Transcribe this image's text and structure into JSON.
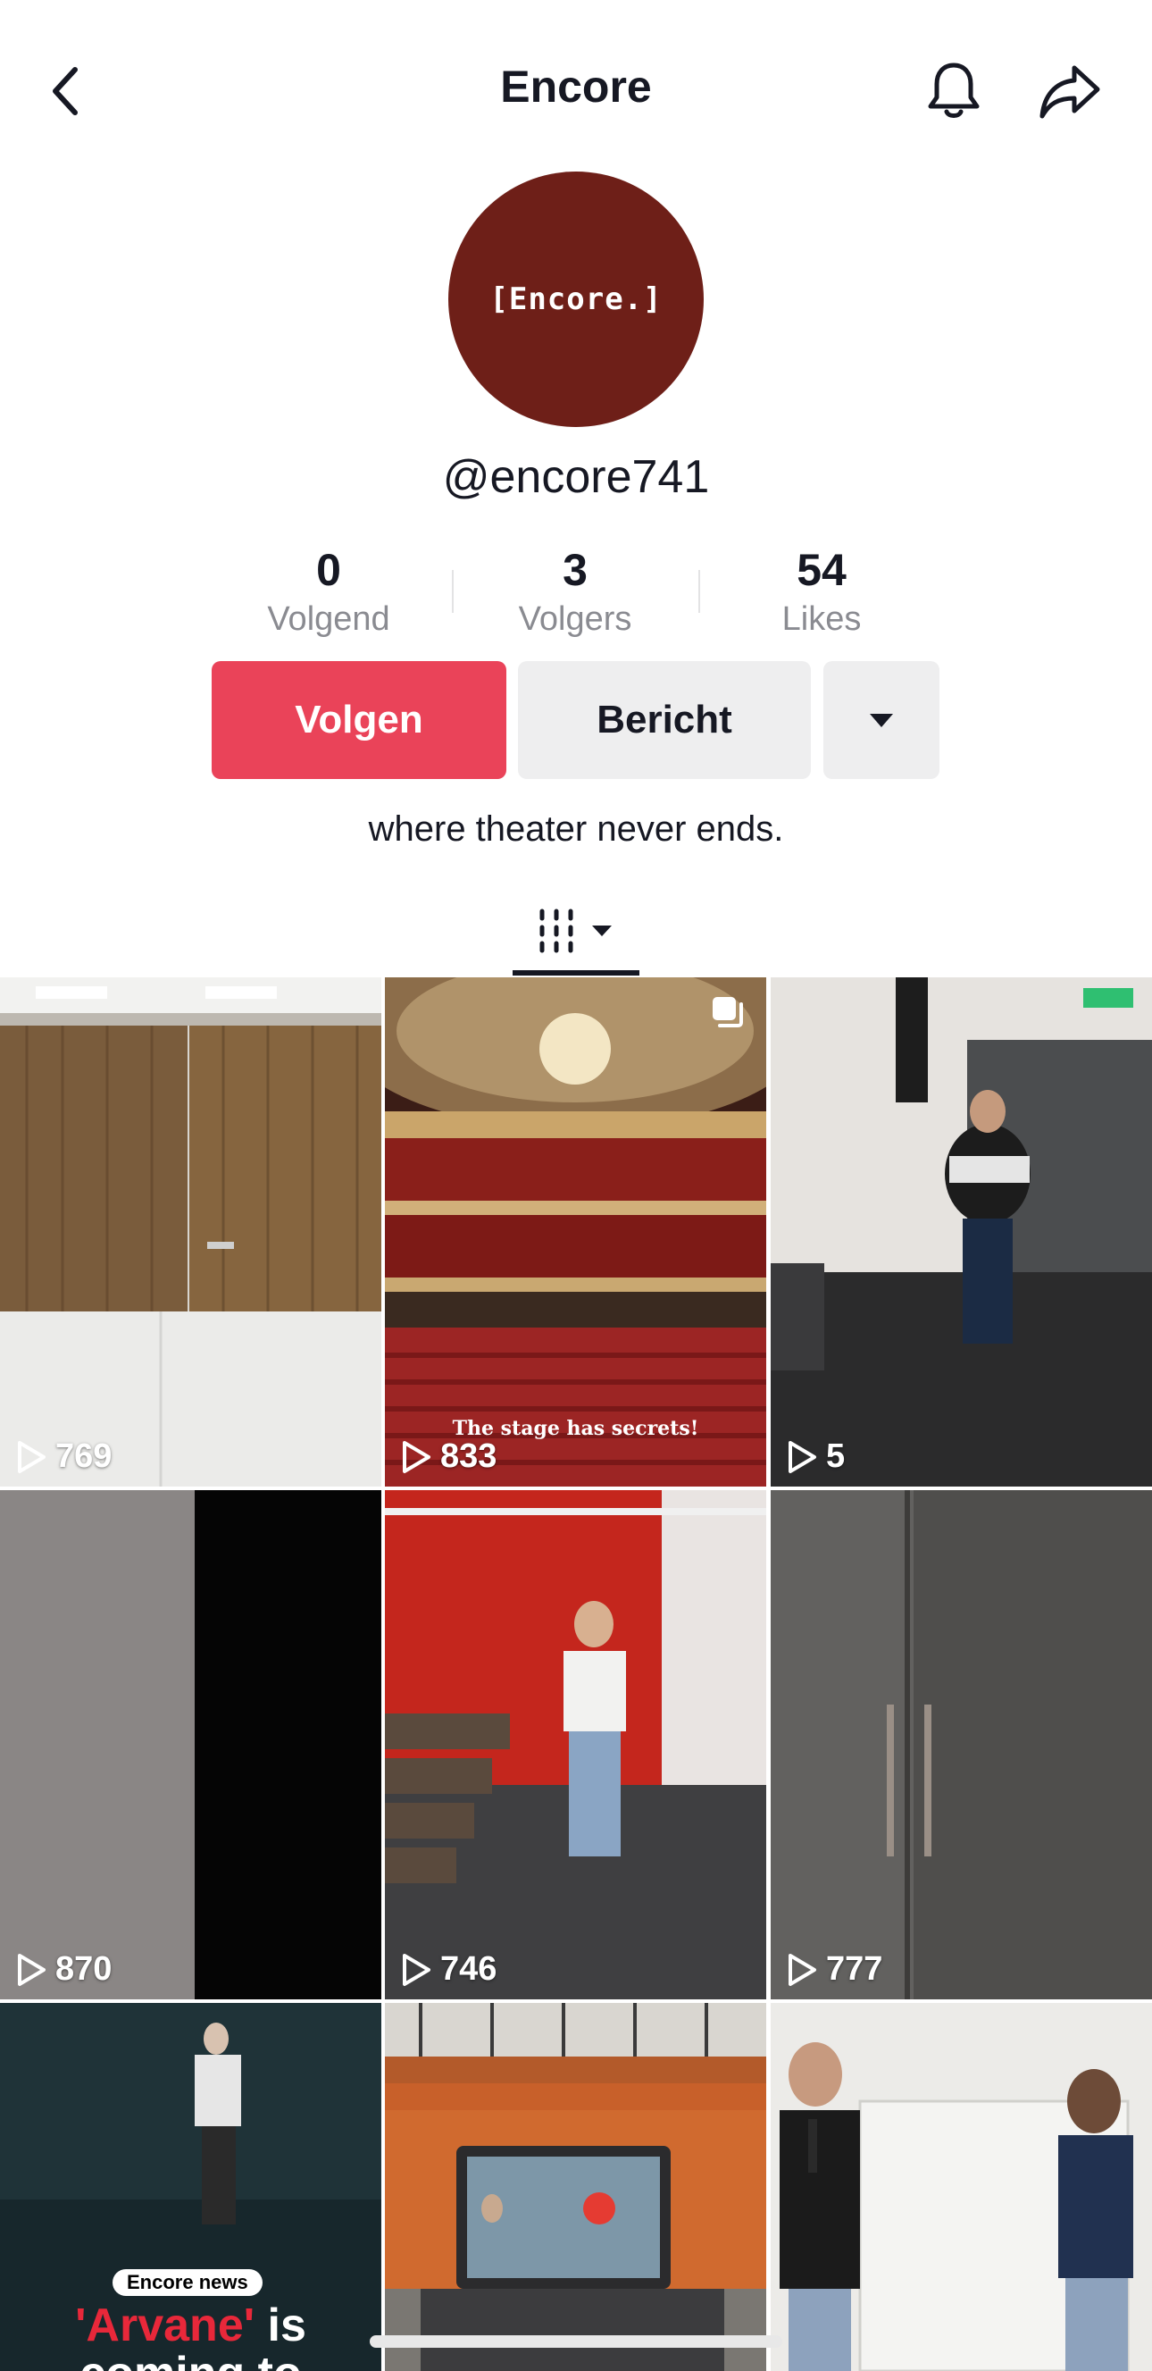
{
  "header": {
    "title": "Encore"
  },
  "profile": {
    "avatar_text": "[Encore.]",
    "username": "@encore741",
    "bio": "where theater never ends."
  },
  "stats": [
    {
      "value": "0",
      "label": "Volgend"
    },
    {
      "value": "3",
      "label": "Volgers"
    },
    {
      "value": "54",
      "label": "Likes"
    }
  ],
  "actions": {
    "follow_label": "Volgen",
    "message_label": "Bericht"
  },
  "tabs": {
    "videos_icon": "grid-columns-icon"
  },
  "videos": [
    {
      "views": "769"
    },
    {
      "views": "833",
      "caption": "The stage has secrets!"
    },
    {
      "views": "5"
    },
    {
      "views": "870"
    },
    {
      "views": "746"
    },
    {
      "views": "777"
    },
    {
      "badge": "Encore news",
      "headline_line1_red": "'Arvane'",
      "headline_line1_rest": " is",
      "headline_line2": "coming to"
    },
    {},
    {}
  ],
  "colors": {
    "accent": "#ea4359",
    "avatar_bg": "#6e1f18"
  }
}
